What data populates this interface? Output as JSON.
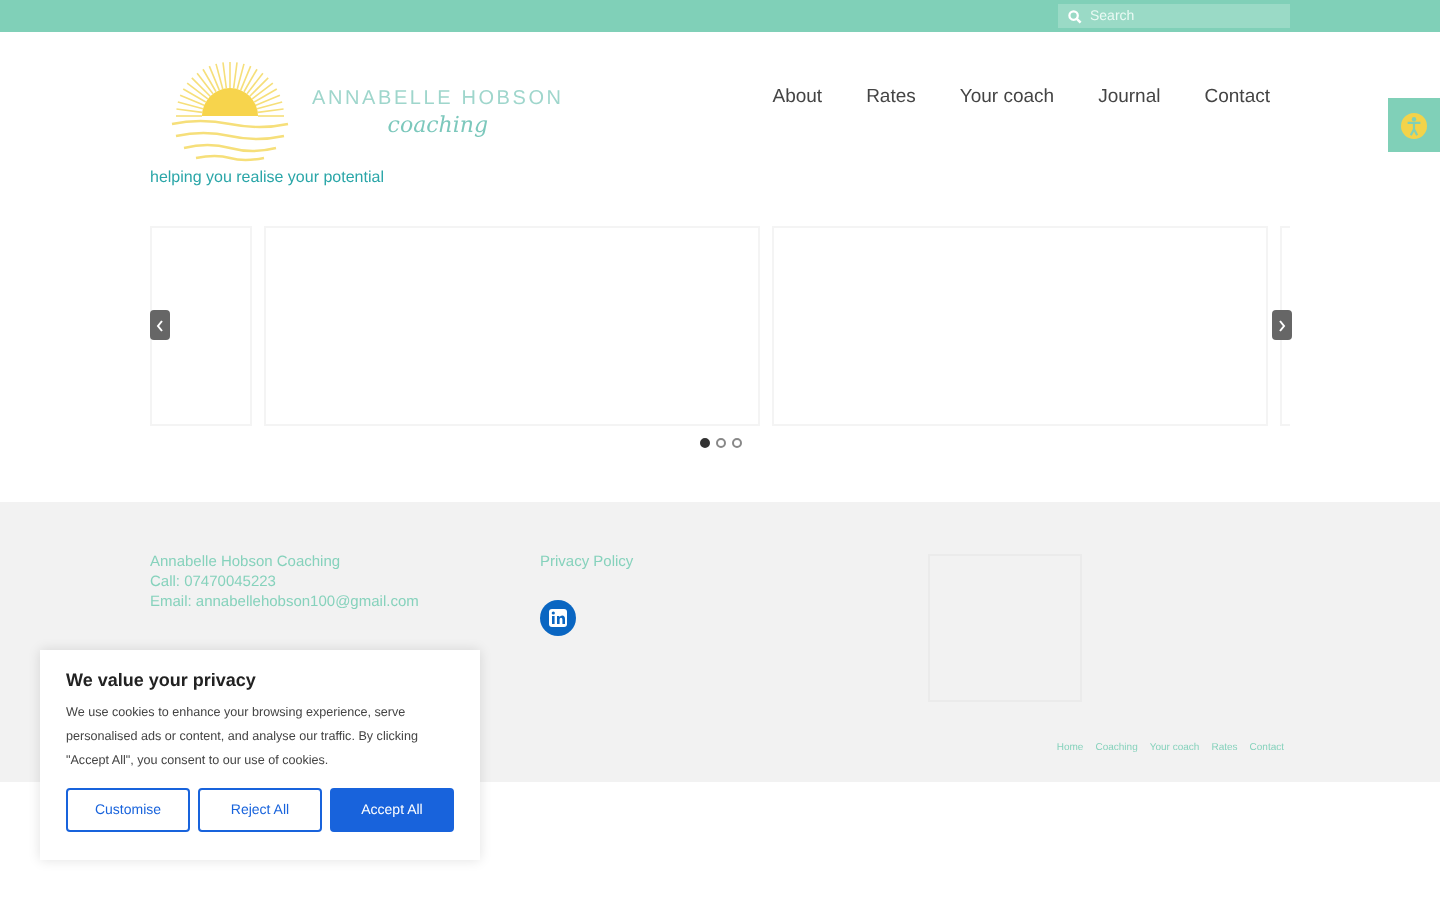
{
  "top_bar": {
    "search": {
      "placeholder": "Search"
    }
  },
  "header": {
    "logo": {
      "name": "ANNABELLE HOBSON",
      "script": "coaching"
    },
    "tagline": "helping you realise your potential",
    "nav": [
      {
        "label": "About"
      },
      {
        "label": "Rates"
      },
      {
        "label": "Your coach"
      },
      {
        "label": "Journal"
      },
      {
        "label": "Contact"
      }
    ]
  },
  "carousel": {
    "dots": [
      {
        "selected": true
      },
      {
        "selected": false
      },
      {
        "selected": false
      }
    ]
  },
  "footer": {
    "contact": [
      "Annabelle Hobson Coaching",
      "Call: 07470045223",
      "Email: annabellehobson100@gmail.com"
    ],
    "privacy": "Privacy Policy",
    "links": [
      "Home",
      "Coaching",
      "Your coach",
      "Rates",
      "Contact"
    ]
  },
  "cookie": {
    "title": "We value your privacy",
    "text": "We use cookies to enhance your browsing experience, serve personalised ads or content, and analyse our traffic. By clicking \"Accept All\", you consent to our use of cookies.",
    "buttons": [
      {
        "label": "Customise",
        "kind": "outline"
      },
      {
        "label": "Reject All",
        "kind": "outline"
      },
      {
        "label": "Accept All",
        "kind": "primary"
      }
    ]
  }
}
